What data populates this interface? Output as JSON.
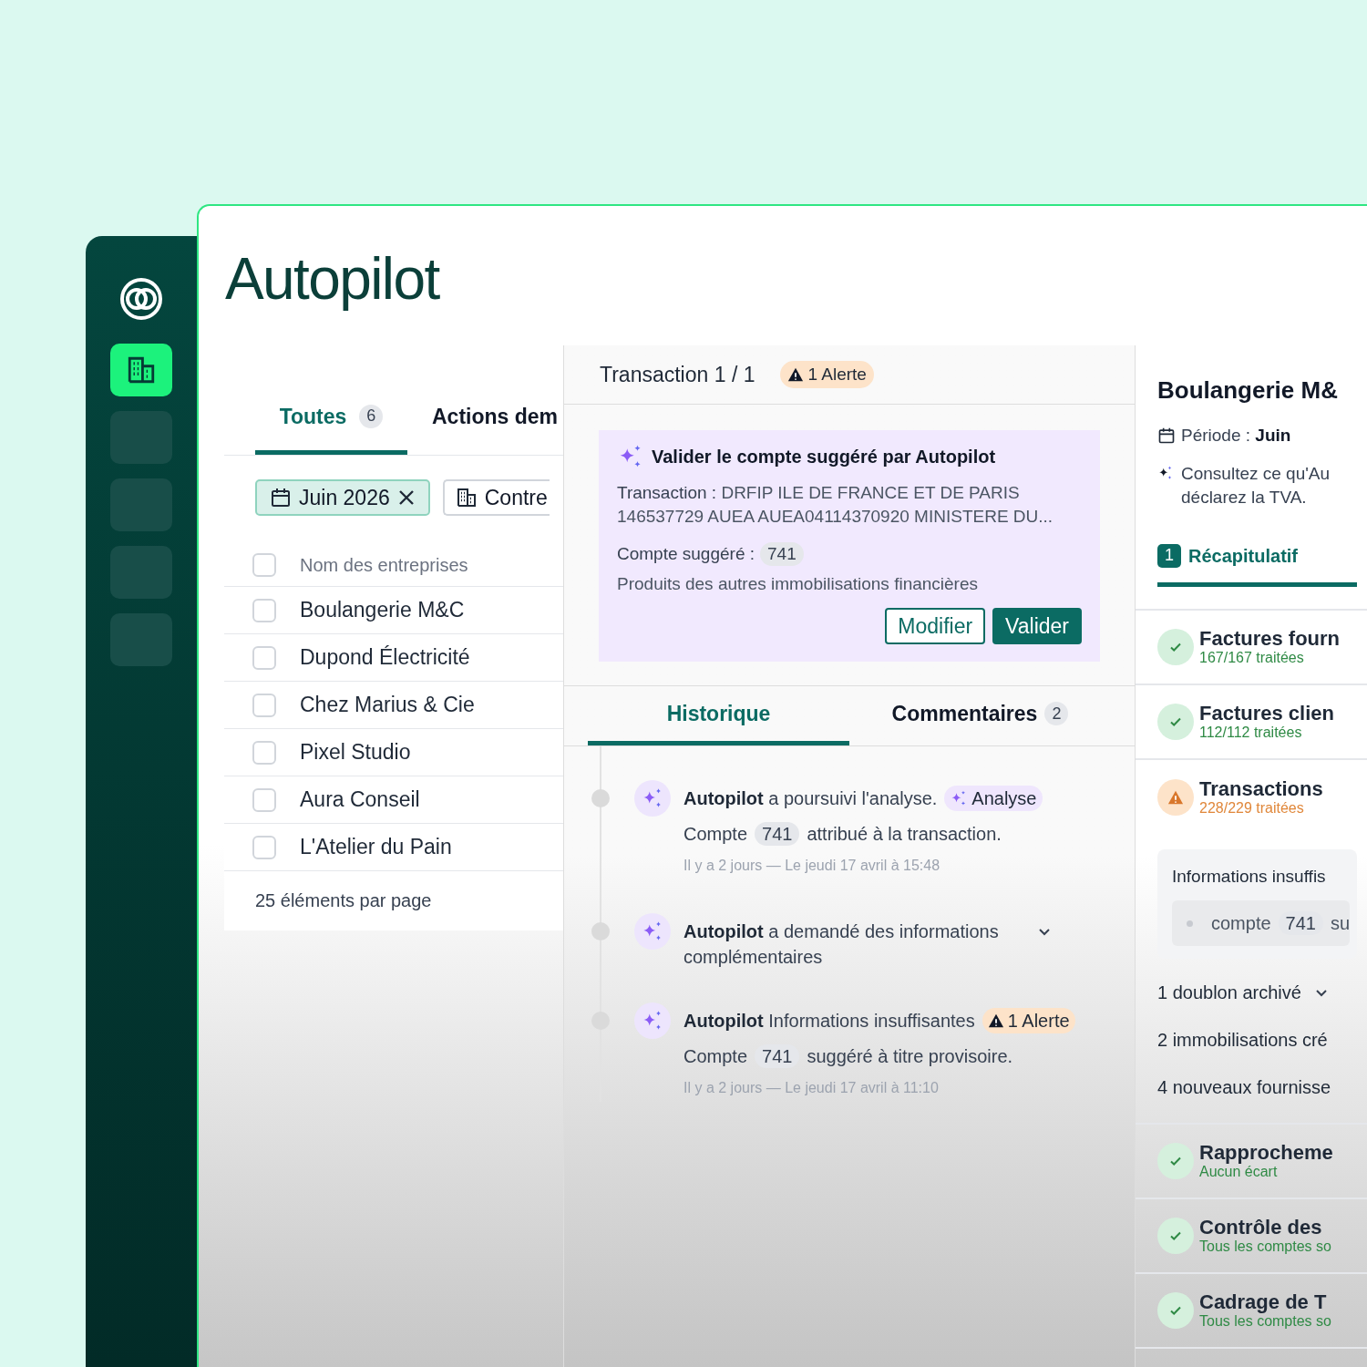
{
  "sidebar": {
    "items": [
      {
        "selected": true
      },
      {
        "selected": false
      },
      {
        "selected": false
      },
      {
        "selected": false
      },
      {
        "selected": false
      }
    ]
  },
  "page_title": "Autopilot",
  "companies": {
    "tabs": [
      {
        "label": "Toutes",
        "count": "6",
        "selected": true
      },
      {
        "label": "Actions dem",
        "selected": false
      }
    ],
    "filters": [
      {
        "kind": "date",
        "label": "Juin 2026",
        "active": true
      },
      {
        "kind": "company",
        "label": "Contre",
        "active": false
      }
    ],
    "header": {
      "label": "Nom des entreprises",
      "checked": false
    },
    "rows": [
      {
        "name": "Boulangerie M&C",
        "checked": false
      },
      {
        "name": "Dupond Électricité",
        "checked": false
      },
      {
        "name": "Chez Marius & Cie",
        "checked": false
      },
      {
        "name": "Pixel Studio",
        "checked": false
      },
      {
        "name": "Aura Conseil",
        "checked": false
      },
      {
        "name": "L'Atelier du Pain",
        "checked": false
      }
    ],
    "footer": "25 éléments par page"
  },
  "transaction": {
    "title": "Transaction 1 / 1",
    "alert": "1 Alerte",
    "suggestion": {
      "title": "Valider le compte suggéré par Autopilot",
      "transaction_label": "Transaction :",
      "transaction_text": "DRFIP ILE DE FRANCE ET DE PARIS 146537729 AUEA AUEA04114370920 MINISTERE DU...",
      "account_label": "Compte suggéré :",
      "account": "741",
      "account_name": "Produits des autres immobilisations financières",
      "buttons": [
        {
          "label": "Modifier",
          "kind": "secondary"
        },
        {
          "label": "Valider",
          "kind": "primary"
        }
      ]
    },
    "tabs": [
      {
        "label": "Historique",
        "selected": true
      },
      {
        "label": "Commentaires",
        "count": "2",
        "selected": false
      }
    ],
    "history": [
      {
        "text": "**Autopilot** a poursuivi l'analyse.",
        "badge": {
          "kind": "analysis",
          "label": "Analyse"
        },
        "detail": {
          "prefix": "Compte",
          "account": "741",
          "suffix": "attribué à la transaction."
        },
        "meta": "Il y a 2 jours — Le jeudi 17 avril à 15:48"
      },
      {
        "text": "**Autopilot**  a demandé des informations complémentaires",
        "expanded": false
      },
      {
        "text": "**Autopilot** Informations insuffisantes",
        "badge": {
          "kind": "alert",
          "label": "1 Alerte"
        },
        "detail": {
          "prefix": "Compte",
          "account": "741",
          "suffix": "suggéré à titre provisoire."
        },
        "meta": "Il y a 2 jours — Le jeudi 17 avril à 11:10"
      }
    ]
  },
  "summary": {
    "company": "Boulangerie M&",
    "period_label": "Période :",
    "period": "Juin",
    "hint_lines": [
      "Consultez ce qu'Au",
      "déclarez la TVA."
    ],
    "tabs": [
      {
        "number": "1",
        "label": "Récapitulatif",
        "selected": true
      }
    ],
    "checks": [
      {
        "title": "Factures fourn",
        "detail": "167/167 traitées",
        "kind": "done"
      },
      {
        "title": "Factures clien",
        "detail": "112/112 traitées",
        "kind": "done"
      },
      {
        "title": "Transactions",
        "detail": "228/229 traitées",
        "kind": "warning",
        "issues": {
          "title": "Informations insuffis",
          "items": [
            {
              "prefix": "compte",
              "account": "741",
              "suffix": "su"
            }
          ],
          "groups": [
            {
              "label": "1 doublon archivé",
              "expanded": false
            },
            {
              "label": "2 immobilisations cré"
            },
            {
              "label": "4 nouveaux fournisse"
            }
          ]
        }
      },
      {
        "title": "Rapprocheme",
        "detail": "Aucun écart",
        "kind": "done"
      },
      {
        "title": "Contrôle des",
        "detail": "Tous les comptes so",
        "kind": "done"
      },
      {
        "title": "Cadrage de T",
        "detail": "Tous les comptes so",
        "kind": "done"
      }
    ]
  }
}
